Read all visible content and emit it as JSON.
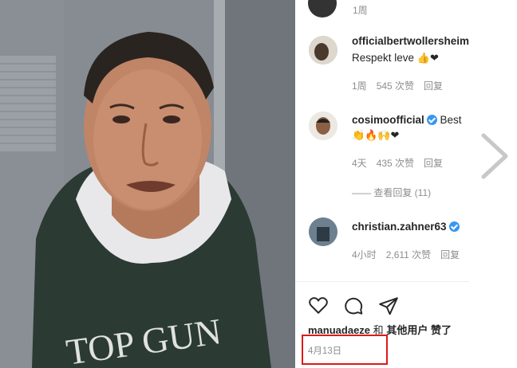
{
  "colors": {
    "accent_red": "#e01818",
    "verified_blue": "#3897f0",
    "meta_gray": "#8e8e8e"
  },
  "video": {
    "hoodie_text": "TOP GUN"
  },
  "comments": {
    "top_meta": {
      "time": "1周"
    },
    "items": [
      {
        "user": "officialbertwollersheim",
        "text": "Respekt leve",
        "emoji": "👍❤",
        "time": "1周",
        "likes": "545 次赞",
        "reply": "回复",
        "verified": false
      },
      {
        "user": "cosimoofficial",
        "text": "Best",
        "emoji": "👏🔥🙌❤",
        "time": "4天",
        "likes": "435 次赞",
        "reply": "回复",
        "verified": true
      },
      {
        "user": "christian.zahner63",
        "text": "",
        "emoji": "",
        "time": "4小时",
        "likes": "2,611 次赞",
        "reply": "回复",
        "verified": true
      }
    ],
    "view_replies": "—— 查看回复 (11)"
  },
  "actions": {
    "like_icon": "heart-icon",
    "comment_icon": "comment-icon",
    "share_icon": "share-icon"
  },
  "liked_by": {
    "user": "manuadaeze",
    "connector": "和",
    "others": "其他用户",
    "suffix": "赞了"
  },
  "post_date": "4月13日",
  "nav": {
    "next_icon": "chevron-right-icon"
  }
}
